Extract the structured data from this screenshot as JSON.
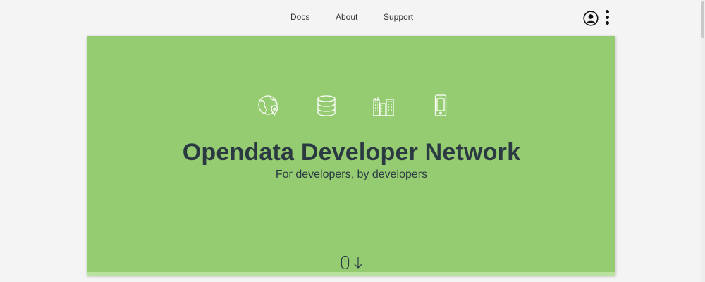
{
  "nav": {
    "links": [
      {
        "label": "Docs"
      },
      {
        "label": "About"
      },
      {
        "label": "Support"
      }
    ],
    "icons": {
      "user": "user-circle-icon",
      "more": "more-vertical-icon"
    }
  },
  "hero": {
    "icons": [
      "globe-location-icon",
      "database-icon",
      "city-buildings-icon",
      "smartphone-icon"
    ],
    "title": "Opendata Developer Network",
    "subtitle": "For developers, by developers",
    "scroll_icons": [
      "mouse-icon",
      "arrow-down-icon"
    ]
  },
  "colors": {
    "page_background": "#f4f4f4",
    "hero_background": "#95cc71",
    "hero_bottom_bar": "#b9e29d",
    "title_text": "#2b3a42",
    "icon_stroke": "#ffffff"
  }
}
